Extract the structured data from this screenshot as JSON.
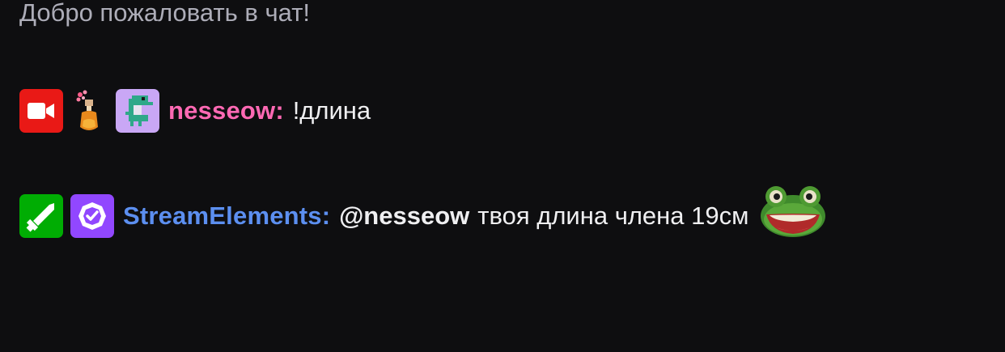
{
  "chat": {
    "welcome_text": "Добро пожаловать в чат!",
    "messages": [
      {
        "badges": [
          "video-camera-icon",
          "potion-badge-icon",
          "pixel-dino-badge-icon"
        ],
        "username": "nesseow",
        "username_color": "#ff69b4",
        "colon": ":",
        "text": "!длина"
      },
      {
        "badges": [
          "moderator-sword-icon",
          "verified-badge-icon"
        ],
        "username": "StreamElements",
        "username_color": "#5c8ff0",
        "colon": ":",
        "mention": "@nesseow",
        "text": "твоя длина члена 19см",
        "emote": "frog-emote"
      }
    ]
  },
  "colors": {
    "background": "#0e0e10",
    "welcome": "#adadb8",
    "text": "#efeff1"
  }
}
